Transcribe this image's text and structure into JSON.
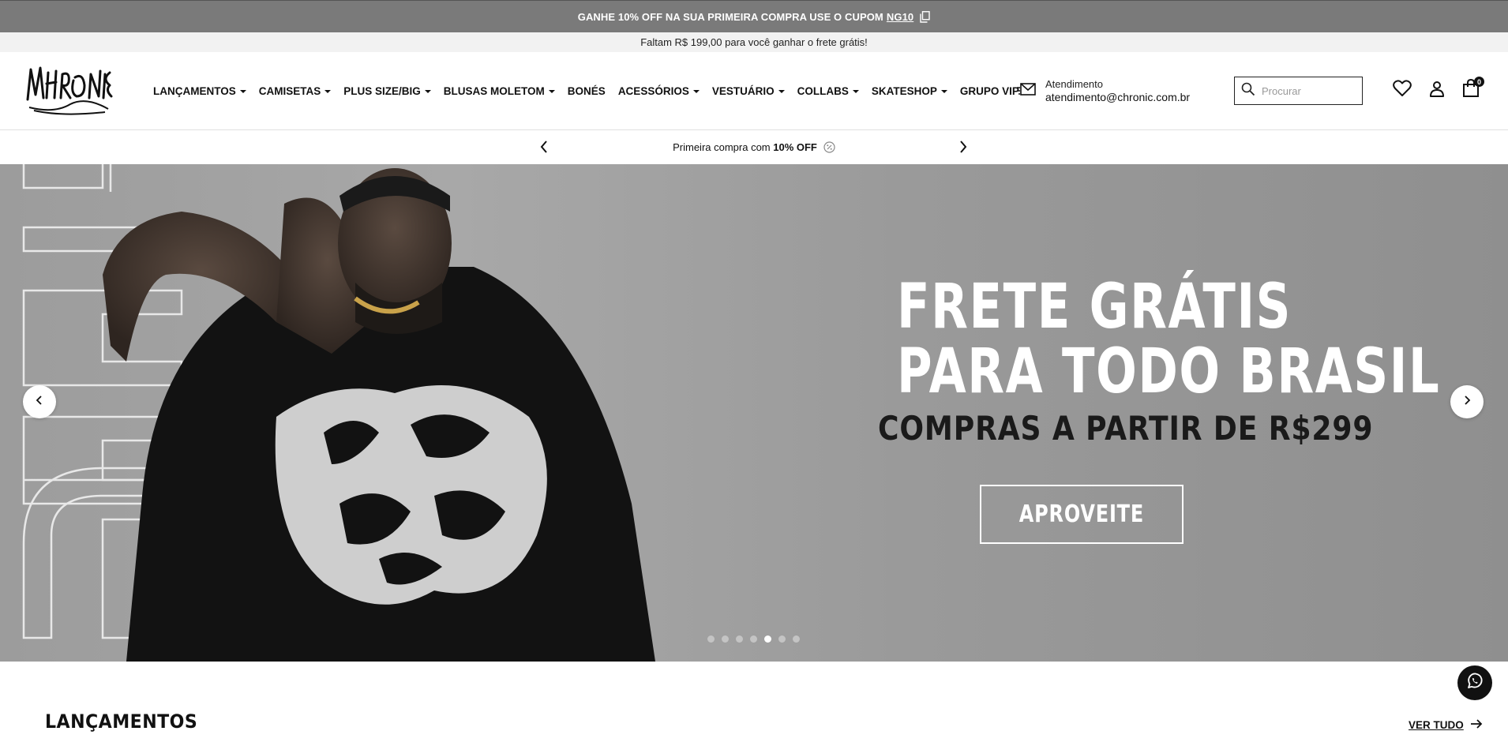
{
  "topbar": {
    "text": "GANHE 10% OFF NA SUA PRIMEIRA COMPRA USE O CUPOM",
    "coupon": "NG10",
    "icon": "copy-icon"
  },
  "shipping": {
    "text": "Faltam R$ 199,00 para você ganhar o frete grátis!"
  },
  "header": {
    "logo": "chronic-logo",
    "nav": [
      {
        "label": "LANÇAMENTOS",
        "dropdown": true
      },
      {
        "label": "CAMISETAS",
        "dropdown": true
      },
      {
        "label": "PLUS SIZE/BIG",
        "dropdown": true
      },
      {
        "label": "BLUSAS MOLETOM",
        "dropdown": true
      },
      {
        "label": "BONÉS",
        "dropdown": false
      },
      {
        "label": "ACESSÓRIOS",
        "dropdown": true
      },
      {
        "label": "VESTUÁRIO",
        "dropdown": true
      },
      {
        "label": "COLLABS",
        "dropdown": true
      },
      {
        "label": "SKATESHOP",
        "dropdown": true
      },
      {
        "label": "GRUPO VIP",
        "dropdown": false
      }
    ],
    "contact": {
      "label": "Atendimento",
      "email": "atendimento@chronic.com.br"
    },
    "search": {
      "placeholder": "Procurar",
      "value": ""
    },
    "cart_count": "0"
  },
  "promo": {
    "text": "Primeira compra com ",
    "bold": "10% OFF"
  },
  "hero": {
    "line1": "FRETE GRÁTIS",
    "line2": "PARA TODO BRASIL",
    "line3": "COMPRAS A PARTIR DE R$299",
    "cta": "APROVEITE",
    "slides_count": 7,
    "active_slide": 5
  },
  "section": {
    "title": "LANÇAMENTOS",
    "link": "VER TUDO"
  },
  "colors": {
    "topbar": "#7a7a7a",
    "hero_bg": "#9c9c9c",
    "text": "#111111"
  }
}
